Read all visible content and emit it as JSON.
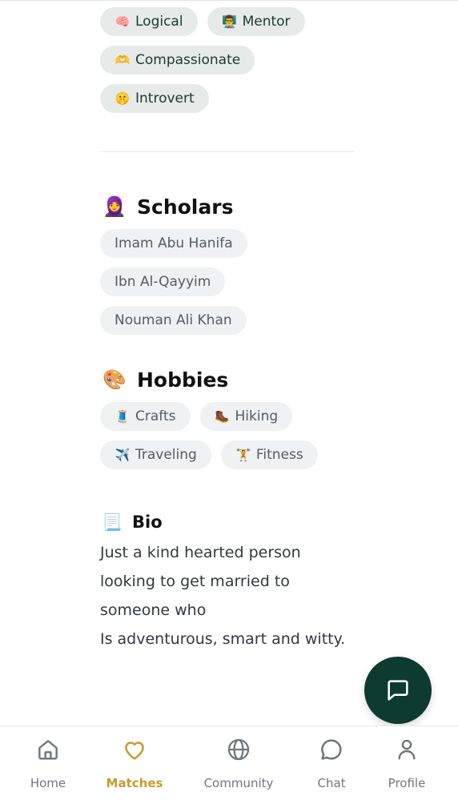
{
  "traits": [
    [
      {
        "emoji": "🧠",
        "label": "Logical"
      },
      {
        "emoji": "👨‍🏫",
        "label": "Mentor"
      }
    ],
    [
      {
        "emoji": "🫶",
        "label": "Compassionate"
      }
    ],
    [
      {
        "emoji": "🤫",
        "label": "Introvert"
      }
    ]
  ],
  "scholars": {
    "emoji": "🧕",
    "title": "Scholars",
    "items": [
      "Imam Abu Hanifa",
      "Ibn Al-Qayyim",
      "Nouman Ali Khan"
    ]
  },
  "hobbies": {
    "emoji": "🎨",
    "title": "Hobbies",
    "rows": [
      [
        {
          "emoji": "🧵",
          "label": "Crafts"
        },
        {
          "emoji": "🥾",
          "label": "Hiking"
        }
      ],
      [
        {
          "emoji": "✈️",
          "label": "Traveling"
        },
        {
          "emoji": "🏋️",
          "label": "Fitness"
        }
      ]
    ]
  },
  "bio": {
    "emoji": "📃",
    "title": "Bio",
    "text": "Just a kind hearted person looking to get married to someone who\nIs adventurous, smart and witty."
  },
  "nav": {
    "items": [
      {
        "label": "Home",
        "icon": "home-icon",
        "active": false
      },
      {
        "label": "Matches",
        "icon": "heart-icon",
        "active": true
      },
      {
        "label": "Community",
        "icon": "globe-icon",
        "active": false
      },
      {
        "label": "Chat",
        "icon": "chat-bubble-icon",
        "active": false
      },
      {
        "label": "Profile",
        "icon": "profile-icon",
        "active": false
      }
    ]
  },
  "colors": {
    "accent": "#c99a2e",
    "fab": "#0d3b2e",
    "trait_chip_bg": "#e6eae8",
    "chip_bg": "#eff1f3"
  }
}
